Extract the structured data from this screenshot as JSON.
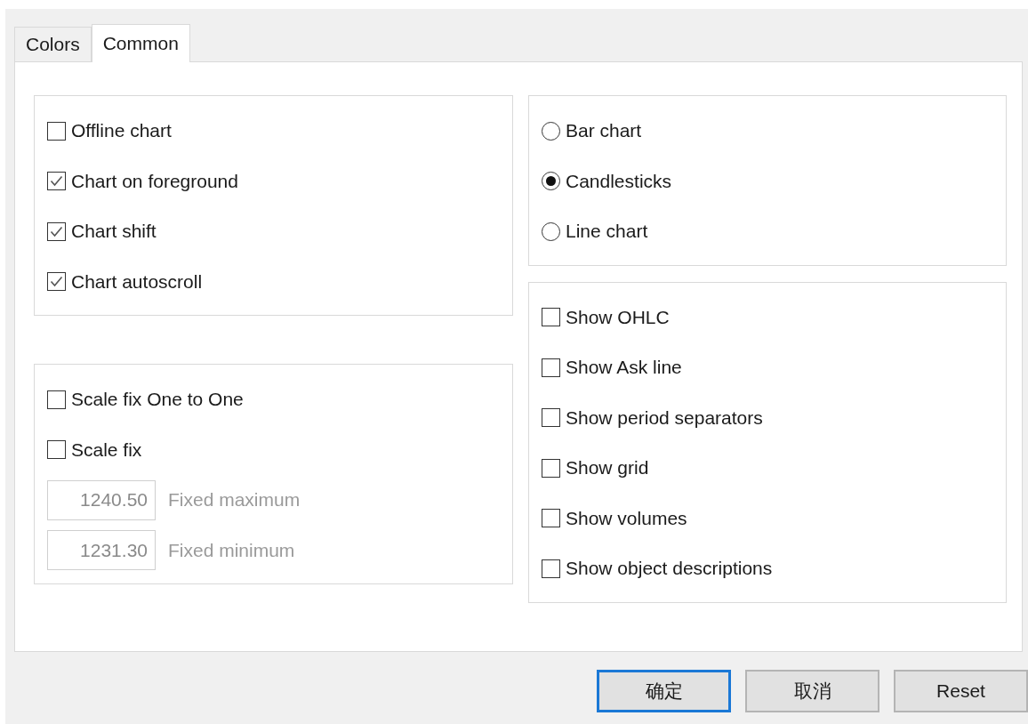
{
  "tabs": [
    {
      "label": "Colors",
      "selected": false
    },
    {
      "label": "Common",
      "selected": true
    }
  ],
  "general_options": [
    {
      "label": "Offline chart",
      "checked": false
    },
    {
      "label": "Chart on foreground",
      "checked": true
    },
    {
      "label": "Chart shift",
      "checked": true
    },
    {
      "label": "Chart autoscroll",
      "checked": true
    }
  ],
  "scale_options": [
    {
      "label": "Scale fix One to One",
      "checked": false
    },
    {
      "label": "Scale fix",
      "checked": false
    }
  ],
  "scale_fields": [
    {
      "value": "1240.50",
      "label": "Fixed maximum",
      "disabled": true
    },
    {
      "value": "1231.30",
      "label": "Fixed minimum",
      "disabled": true
    }
  ],
  "chart_type": [
    {
      "label": "Bar chart",
      "selected": false
    },
    {
      "label": "Candlesticks",
      "selected": true
    },
    {
      "label": "Line chart",
      "selected": false
    }
  ],
  "show_options": [
    {
      "label": "Show OHLC",
      "checked": false
    },
    {
      "label": "Show Ask line",
      "checked": false
    },
    {
      "label": "Show period separators",
      "checked": false
    },
    {
      "label": "Show grid",
      "checked": false
    },
    {
      "label": "Show volumes",
      "checked": false
    },
    {
      "label": "Show object descriptions",
      "checked": false
    }
  ],
  "buttons": [
    {
      "label": "确定",
      "default": true
    },
    {
      "label": "取消",
      "default": false
    },
    {
      "label": "Reset",
      "default": false
    }
  ]
}
